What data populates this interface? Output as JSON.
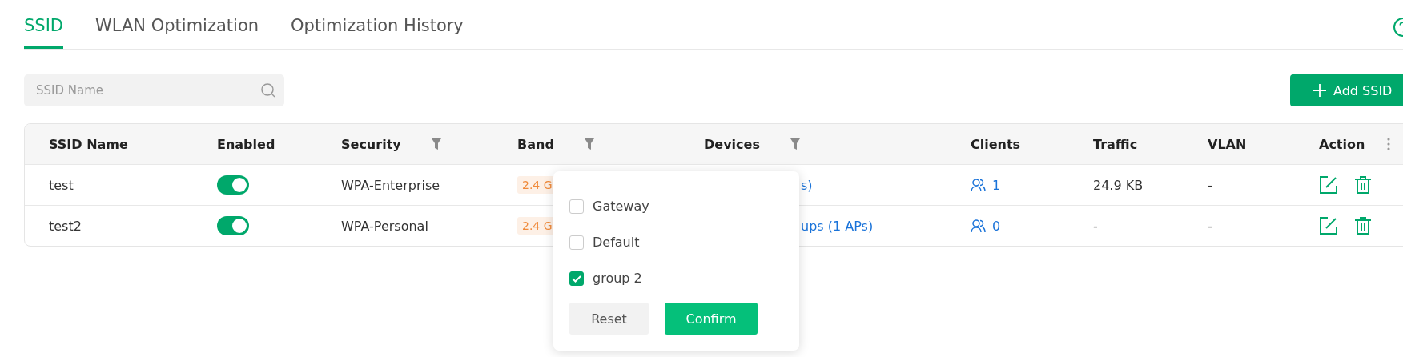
{
  "tabs": [
    {
      "label": "SSID",
      "selected": true
    },
    {
      "label": "WLAN Optimization",
      "selected": false
    },
    {
      "label": "Optimization History",
      "selected": false
    }
  ],
  "search": {
    "placeholder": "SSID Name"
  },
  "add_button": {
    "label": "Add SSID"
  },
  "table": {
    "columns": [
      {
        "label": "SSID Name",
        "filterable": false
      },
      {
        "label": "Enabled",
        "filterable": false
      },
      {
        "label": "Security",
        "filterable": true
      },
      {
        "label": "Band",
        "filterable": true
      },
      {
        "label": "Devices",
        "filterable": true
      },
      {
        "label": "Clients",
        "filterable": false
      },
      {
        "label": "Traffic",
        "filterable": false
      },
      {
        "label": "VLAN",
        "filterable": false
      },
      {
        "label": "Action",
        "filterable": false
      }
    ],
    "rows": [
      {
        "ssid": "test",
        "enabled": true,
        "security": "WPA-Enterprise",
        "band": "2.4 G",
        "devices": "s)",
        "clients": "1",
        "traffic": "24.9 KB",
        "vlan": "-"
      },
      {
        "ssid": "test2",
        "enabled": true,
        "security": "WPA-Personal",
        "band": "2.4 G",
        "devices": "ups (1 APs)",
        "clients": "0",
        "traffic": "-",
        "vlan": "-"
      }
    ]
  },
  "filter_popup": {
    "options": [
      {
        "label": "Gateway",
        "checked": false
      },
      {
        "label": "Default",
        "checked": false
      },
      {
        "label": "group 2",
        "checked": true
      }
    ],
    "buttons": [
      {
        "label": "Reset",
        "kind": "secondary"
      },
      {
        "label": "Confirm",
        "kind": "primary"
      }
    ]
  }
}
